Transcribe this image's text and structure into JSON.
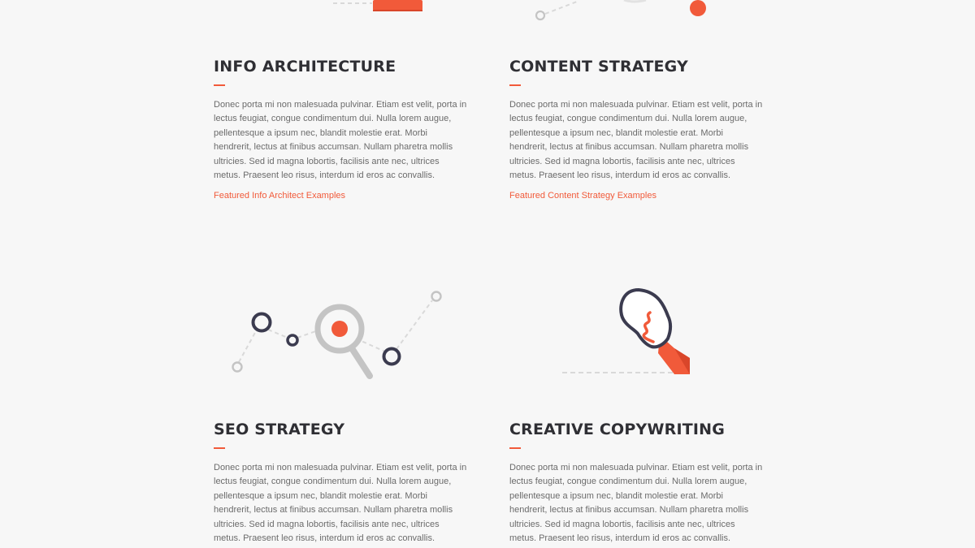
{
  "services": [
    {
      "title": "INFO ARCHITECTURE",
      "body": "Donec porta mi non malesuada pulvinar. Etiam est velit, porta in lectus feugiat, congue condimentum dui. Nulla lorem augue, pellentesque a ipsum nec, blandit molestie erat. Morbi hendrerit, lectus at finibus accumsan. Nullam pharetra mollis ultricies. Sed id magna lobortis, facilisis ante nec, ultrices metus. Praesent leo risus, interdum id eros ac convallis.",
      "link": "Featured Info Architect Examples"
    },
    {
      "title": "CONTENT STRATEGY",
      "body": "Donec porta mi non malesuada pulvinar. Etiam est velit, porta in lectus feugiat, congue condimentum dui. Nulla lorem augue, pellentesque a ipsum nec, blandit molestie erat. Morbi hendrerit, lectus at finibus accumsan. Nullam pharetra mollis ultricies. Sed id magna lobortis, facilisis ante nec, ultrices metus. Praesent leo risus, interdum id eros ac convallis.",
      "link": "Featured Content Strategy Examples"
    },
    {
      "title": "SEO STRATEGY",
      "body": "Donec porta mi non malesuada pulvinar. Etiam est velit, porta in lectus feugiat, congue condimentum dui. Nulla lorem augue, pellentesque a ipsum nec, blandit molestie erat. Morbi hendrerit, lectus at finibus accumsan. Nullam pharetra mollis ultricies. Sed id magna lobortis, facilisis ante nec, ultrices metus. Praesent leo risus, interdum id eros ac convallis."
    },
    {
      "title": "CREATIVE COPYWRITING",
      "body": "Donec porta mi non malesuada pulvinar. Etiam est velit, porta in lectus feugiat, congue condimentum dui. Nulla lorem augue, pellentesque a ipsum nec, blandit molestie erat. Morbi hendrerit, lectus at finibus accumsan. Nullam pharetra mollis ultricies. Sed id magna lobortis, facilisis ante nec, ultrices metus. Praesent leo risus, interdum id eros ac convallis."
    }
  ],
  "icons": [
    "info-architecture-icon",
    "content-strategy-icon",
    "seo-magnifier-icon",
    "lightbulb-icon"
  ],
  "colors": {
    "accent": "#f15a3a",
    "dark": "#3b3b4f",
    "grey": "#c4c4c4",
    "heading": "#2f2f34",
    "body_text": "#6b6b6b",
    "background": "#f7f7f7"
  }
}
